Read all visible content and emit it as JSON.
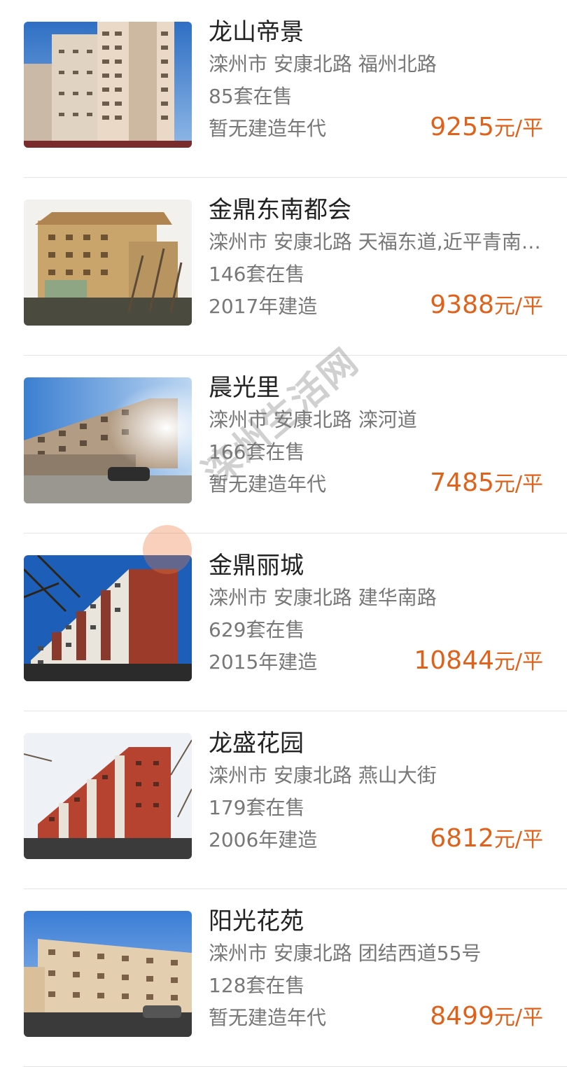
{
  "listings": [
    {
      "name": "龙山帝景",
      "address": "滦州市 安康北路 福州北路",
      "on_sale": "85套在售",
      "year": "暂无建造年代",
      "price_num": "9255",
      "price_unit": "元/平",
      "photo": "tall-tower"
    },
    {
      "name": "金鼎东南都会",
      "address": "滦州市 安康北路 天福东道,近平青南…",
      "on_sale": "146套在售",
      "year": "2017年建造",
      "price_num": "9388",
      "price_unit": "元/平",
      "photo": "yellow-building"
    },
    {
      "name": "晨光里",
      "address": "滦州市 安康北路 滦河道",
      "on_sale": "166套在售",
      "year": "暂无建造年代",
      "price_num": "7485",
      "price_unit": "元/平",
      "photo": "sunny-building"
    },
    {
      "name": "金鼎丽城",
      "address": "滦州市 安康北路 建华南路",
      "on_sale": "629套在售",
      "year": "2015年建造",
      "price_num": "10844",
      "price_unit": "元/平",
      "photo": "red-white-building"
    },
    {
      "name": "龙盛花园",
      "address": "滦州市 安康北路 燕山大街",
      "on_sale": "179套在售",
      "year": "2006年建造",
      "price_num": "6812",
      "price_unit": "元/平",
      "photo": "red-building"
    },
    {
      "name": "阳光花苑",
      "address": "滦州市 安康北路 团结西道55号",
      "on_sale": "128套在售",
      "year": "暂无建造年代",
      "price_num": "8499",
      "price_unit": "元/平",
      "photo": "beige-building"
    }
  ],
  "watermark": {
    "text": "滦州生活网"
  },
  "colors": {
    "price": "#e0611a",
    "title": "#222222",
    "meta": "#777777",
    "divider": "#e4e4e4"
  }
}
